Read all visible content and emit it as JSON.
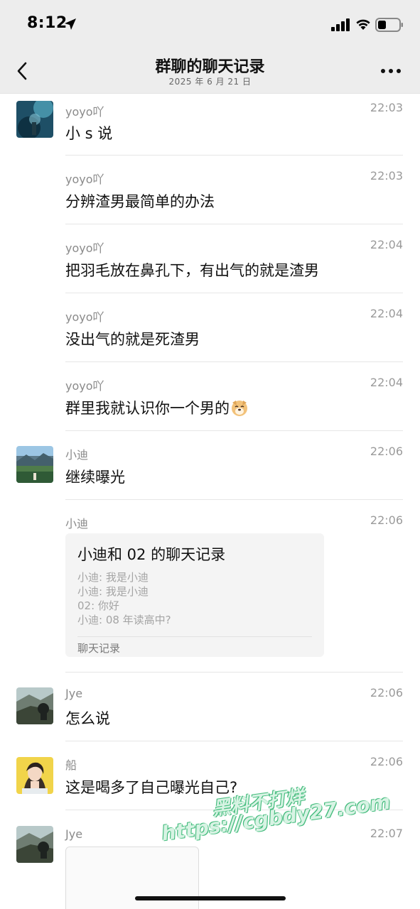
{
  "status": {
    "time": "8:12"
  },
  "nav": {
    "title": "群聊的聊天记录",
    "subtitle": "2025 年 6 月 21 日"
  },
  "messages": [
    {
      "sender": "yoyo吖",
      "time": "22:03",
      "text": "小 s 说",
      "avatar": "underwater-photo"
    },
    {
      "sender": "yoyo吖",
      "time": "22:03",
      "text": "分辨渣男最简单的办法"
    },
    {
      "sender": "yoyo吖",
      "time": "22:04",
      "text": "把羽毛放在鼻孔下，有出气的就是渣男"
    },
    {
      "sender": "yoyo吖",
      "time": "22:04",
      "text": "没出气的就是死渣男"
    },
    {
      "sender": "yoyo吖",
      "time": "22:04",
      "text": "群里我就认识你一个男的",
      "emoji": "dog-face-emoji"
    },
    {
      "sender": "小迪",
      "time": "22:06",
      "text": "继续曝光",
      "avatar": "lake-landscape-photo"
    },
    {
      "sender": "小迪",
      "time": "22:06"
    },
    {
      "sender": "Jye",
      "time": "22:06",
      "text": "怎么说",
      "avatar": "rocky-landscape-photo"
    },
    {
      "sender": "船",
      "time": "22:06",
      "text": "这是喝多了自己曝光自己?",
      "avatar": "woman-portrait-photo"
    },
    {
      "sender": "Jye",
      "time": "22:07",
      "avatar": "rocky-landscape-photo"
    }
  ],
  "card": {
    "title": "小迪和 02 的聊天记录",
    "lines": [
      "小迪: 我是小迪",
      "小迪: 我是小迪",
      "02: 你好",
      "小迪: 08 年读高中?"
    ],
    "footer": "聊天记录"
  },
  "watermark": {
    "line1": "黑料不打烊",
    "line2": "https://cgbdy27.com"
  }
}
